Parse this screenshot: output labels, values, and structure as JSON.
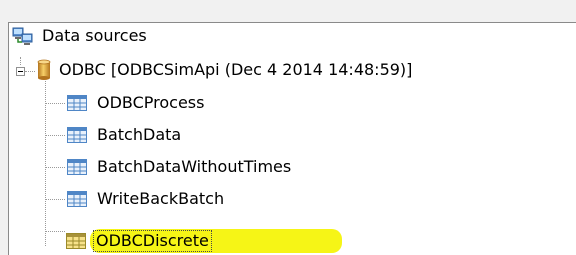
{
  "tree": {
    "root": {
      "label": "Data sources",
      "icon": "network-computers-icon"
    },
    "connection": {
      "label": "ODBC [ODBCSimApi (Dec  4 2014 14:48:59)]",
      "icon": "database-cylinder-icon",
      "expanded": true
    },
    "tables": [
      {
        "label": "ODBCProcess",
        "icon": "table-icon",
        "selected": false
      },
      {
        "label": "BatchData",
        "icon": "table-icon",
        "selected": false
      },
      {
        "label": "BatchDataWithoutTimes",
        "icon": "table-icon",
        "selected": false
      },
      {
        "label": "WriteBackBatch",
        "icon": "table-icon",
        "selected": false
      },
      {
        "label": "ODBCDiscrete",
        "icon": "table-icon",
        "selected": true
      }
    ]
  },
  "colors": {
    "highlight": "#f2f500",
    "table_icon_blue": "#4f86c6",
    "cylinder_gold": "#e0a23a"
  }
}
